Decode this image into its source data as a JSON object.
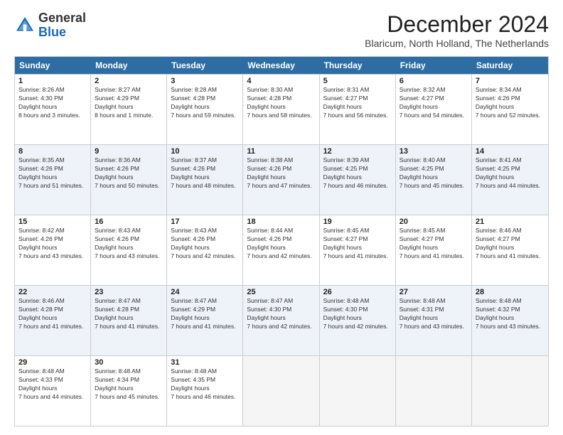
{
  "logo": {
    "general": "General",
    "blue": "Blue"
  },
  "header": {
    "month": "December 2024",
    "location": "Blaricum, North Holland, The Netherlands"
  },
  "weekdays": [
    "Sunday",
    "Monday",
    "Tuesday",
    "Wednesday",
    "Thursday",
    "Friday",
    "Saturday"
  ],
  "rows": [
    [
      {
        "day": "1",
        "sunrise": "8:26 AM",
        "sunset": "4:30 PM",
        "daylight": "8 hours and 3 minutes."
      },
      {
        "day": "2",
        "sunrise": "8:27 AM",
        "sunset": "4:29 PM",
        "daylight": "8 hours and 1 minute."
      },
      {
        "day": "3",
        "sunrise": "8:28 AM",
        "sunset": "4:28 PM",
        "daylight": "7 hours and 59 minutes."
      },
      {
        "day": "4",
        "sunrise": "8:30 AM",
        "sunset": "4:28 PM",
        "daylight": "7 hours and 58 minutes."
      },
      {
        "day": "5",
        "sunrise": "8:31 AM",
        "sunset": "4:27 PM",
        "daylight": "7 hours and 56 minutes."
      },
      {
        "day": "6",
        "sunrise": "8:32 AM",
        "sunset": "4:27 PM",
        "daylight": "7 hours and 54 minutes."
      },
      {
        "day": "7",
        "sunrise": "8:34 AM",
        "sunset": "4:26 PM",
        "daylight": "7 hours and 52 minutes."
      }
    ],
    [
      {
        "day": "8",
        "sunrise": "8:35 AM",
        "sunset": "4:26 PM",
        "daylight": "7 hours and 51 minutes."
      },
      {
        "day": "9",
        "sunrise": "8:36 AM",
        "sunset": "4:26 PM",
        "daylight": "7 hours and 50 minutes."
      },
      {
        "day": "10",
        "sunrise": "8:37 AM",
        "sunset": "4:26 PM",
        "daylight": "7 hours and 48 minutes."
      },
      {
        "day": "11",
        "sunrise": "8:38 AM",
        "sunset": "4:26 PM",
        "daylight": "7 hours and 47 minutes."
      },
      {
        "day": "12",
        "sunrise": "8:39 AM",
        "sunset": "4:25 PM",
        "daylight": "7 hours and 46 minutes."
      },
      {
        "day": "13",
        "sunrise": "8:40 AM",
        "sunset": "4:25 PM",
        "daylight": "7 hours and 45 minutes."
      },
      {
        "day": "14",
        "sunrise": "8:41 AM",
        "sunset": "4:25 PM",
        "daylight": "7 hours and 44 minutes."
      }
    ],
    [
      {
        "day": "15",
        "sunrise": "8:42 AM",
        "sunset": "4:26 PM",
        "daylight": "7 hours and 43 minutes."
      },
      {
        "day": "16",
        "sunrise": "8:43 AM",
        "sunset": "4:26 PM",
        "daylight": "7 hours and 43 minutes."
      },
      {
        "day": "17",
        "sunrise": "8:43 AM",
        "sunset": "4:26 PM",
        "daylight": "7 hours and 42 minutes."
      },
      {
        "day": "18",
        "sunrise": "8:44 AM",
        "sunset": "4:26 PM",
        "daylight": "7 hours and 42 minutes."
      },
      {
        "day": "19",
        "sunrise": "8:45 AM",
        "sunset": "4:27 PM",
        "daylight": "7 hours and 41 minutes."
      },
      {
        "day": "20",
        "sunrise": "8:45 AM",
        "sunset": "4:27 PM",
        "daylight": "7 hours and 41 minutes."
      },
      {
        "day": "21",
        "sunrise": "8:46 AM",
        "sunset": "4:27 PM",
        "daylight": "7 hours and 41 minutes."
      }
    ],
    [
      {
        "day": "22",
        "sunrise": "8:46 AM",
        "sunset": "4:28 PM",
        "daylight": "7 hours and 41 minutes."
      },
      {
        "day": "23",
        "sunrise": "8:47 AM",
        "sunset": "4:28 PM",
        "daylight": "7 hours and 41 minutes."
      },
      {
        "day": "24",
        "sunrise": "8:47 AM",
        "sunset": "4:29 PM",
        "daylight": "7 hours and 41 minutes."
      },
      {
        "day": "25",
        "sunrise": "8:47 AM",
        "sunset": "4:30 PM",
        "daylight": "7 hours and 42 minutes."
      },
      {
        "day": "26",
        "sunrise": "8:48 AM",
        "sunset": "4:30 PM",
        "daylight": "7 hours and 42 minutes."
      },
      {
        "day": "27",
        "sunrise": "8:48 AM",
        "sunset": "4:31 PM",
        "daylight": "7 hours and 43 minutes."
      },
      {
        "day": "28",
        "sunrise": "8:48 AM",
        "sunset": "4:32 PM",
        "daylight": "7 hours and 43 minutes."
      }
    ],
    [
      {
        "day": "29",
        "sunrise": "8:48 AM",
        "sunset": "4:33 PM",
        "daylight": "7 hours and 44 minutes."
      },
      {
        "day": "30",
        "sunrise": "8:48 AM",
        "sunset": "4:34 PM",
        "daylight": "7 hours and 45 minutes."
      },
      {
        "day": "31",
        "sunrise": "8:48 AM",
        "sunset": "4:35 PM",
        "daylight": "7 hours and 46 minutes."
      },
      null,
      null,
      null,
      null
    ]
  ]
}
